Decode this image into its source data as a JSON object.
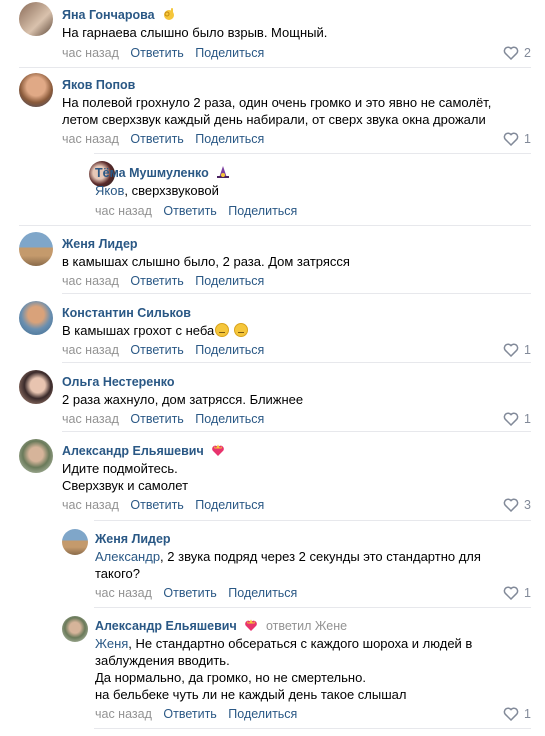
{
  "actions": {
    "reply": "Ответить",
    "share": "Поделиться"
  },
  "comments": [
    {
      "author": "Яна Гончарова",
      "badge": "ok-hand-emoji",
      "lines": [
        "На гарнаева слышно было взрыв. Мощный."
      ],
      "date": "час назад",
      "likes": "2"
    },
    {
      "author": "Яков Попов",
      "lines": [
        "На полевой грохнуло 2 раза, один очень громко и это явно не самолёт,",
        "летом сверхзвук каждый день набирали, от сверх звука окна дрожали"
      ],
      "date": "час назад",
      "likes": "1"
    },
    {
      "author": "Тёма Мушмуленко",
      "badge": "witch-emoji",
      "mention": "Яков",
      "lines": [
        ", сверхзвуковой"
      ],
      "date": "час назад",
      "likes": ""
    },
    {
      "author": "Женя Лидер",
      "lines": [
        "в камышах слышно было, 2 раза. Дом затрясся"
      ],
      "date": "час назад",
      "likes": ""
    },
    {
      "author": "Константин Сильков",
      "lines": [
        "В камышах грохот с неба"
      ],
      "emoji": "confused-face-emoji",
      "date": "час назад",
      "likes": "1"
    },
    {
      "author": "Ольга Нестеренко",
      "lines": [
        "2 раза жахнуло, дом затрясся. Ближнее"
      ],
      "date": "час назад",
      "likes": "1"
    },
    {
      "author": "Александр Ельяшевич",
      "badge": "crown-heart-emoji",
      "lines": [
        "Идите подмойтесь.",
        "Сверхзвук и самолет"
      ],
      "date": "час назад",
      "likes": "3"
    },
    {
      "author": "Женя Лидер",
      "mention": "Александр",
      "lines": [
        ", 2 звука подряд через 2 секунды это стандартно для",
        "такого?"
      ],
      "date": "час назад",
      "likes": "1"
    },
    {
      "author": "Александр Ельяшевич",
      "badge": "crown-heart-emoji",
      "answered": "ответил Жене",
      "mention": "Женя",
      "lines": [
        ", Не стандартно обсераться с каждого шороха и людей в",
        "заблуждения вводить.",
        "Да нормально, да громко, но не смертельно.",
        "на бельбеке чуть ли не каждый день такое слышал"
      ],
      "date": "час назад",
      "likes": "1"
    }
  ],
  "colors": {
    "link": "#2a5885",
    "meta": "#939393",
    "divider": "#e7e8ec"
  }
}
